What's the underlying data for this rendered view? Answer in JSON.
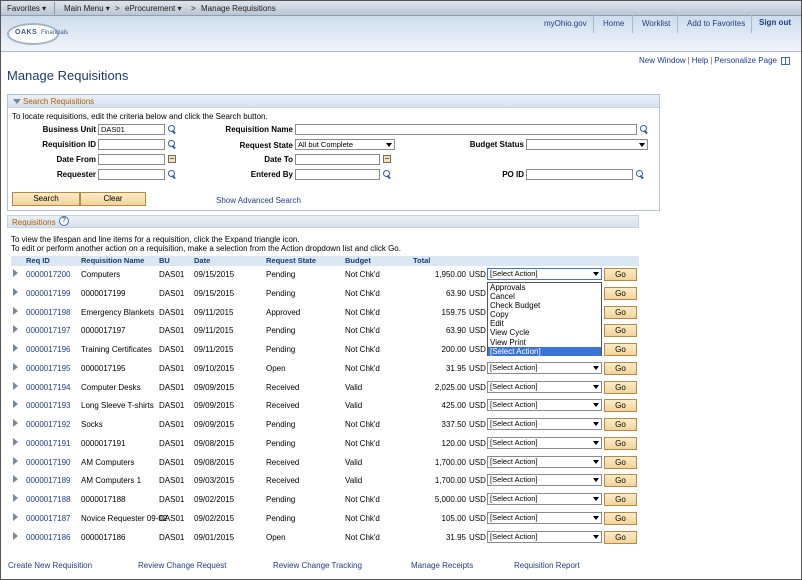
{
  "topnav": {
    "favorites": "Favorites",
    "main_menu": "Main Menu",
    "breadcrumb_1": "eProcurement",
    "breadcrumb_sep": ">",
    "breadcrumb_2": "Manage Requisitions"
  },
  "header": {
    "logo_text": "OAKS",
    "logo_sub": "Financials",
    "links": [
      "myOhio.gov",
      "Home",
      "Worklist",
      "Add to Favorites",
      "Sign out"
    ]
  },
  "page_links": [
    "New Window",
    "Help",
    "Personalize Page"
  ],
  "page_title": "Manage Requisitions",
  "search": {
    "section_title": "Search Requisitions",
    "instructions": "To locate requisitions, edit the criteria below and click the Search button.",
    "labels": {
      "business_unit": "Business Unit",
      "requisition_name": "Requisition Name",
      "requisition_id": "Requisition ID",
      "request_state": "Request State",
      "budget_status": "Budget Status",
      "date_from": "Date From",
      "date_to": "Date To",
      "requester": "Requester",
      "entered_by": "Entered By",
      "po_id": "PO ID"
    },
    "values": {
      "business_unit": "DAS01",
      "request_state": "All but Complete"
    },
    "search_button": "Search",
    "clear_button": "Clear",
    "advanced_link": "Show Advanced Search"
  },
  "requisitions": {
    "section_title": "Requisitions",
    "help_glyph": "?",
    "instructions_1": "To view the lifespan and line items for a requisition, click the Expand triangle icon.",
    "instructions_2": "To edit or perform another action on a requisition, make a selection from the Action dropdown list and click Go.",
    "columns": [
      "Req ID",
      "Requisition Name",
      "BU",
      "Date",
      "Request State",
      "Budget",
      "Total"
    ],
    "action_placeholder": "[Select Action]",
    "go_label": "Go",
    "rows": [
      {
        "id": "0000017200",
        "name": "Computers",
        "bu": "DAS01",
        "date": "09/15/2015",
        "state": "Pending",
        "budget": "Not Chk'd",
        "total": "1,950.00",
        "cur": "USD"
      },
      {
        "id": "0000017199",
        "name": "0000017199",
        "bu": "DAS01",
        "date": "09/15/2015",
        "state": "Pending",
        "budget": "Not Chk'd",
        "total": "63.90",
        "cur": "USD"
      },
      {
        "id": "0000017198",
        "name": "Emergency Blankets",
        "bu": "DAS01",
        "date": "09/11/2015",
        "state": "Approved",
        "budget": "Not Chk'd",
        "total": "159.75",
        "cur": "USD"
      },
      {
        "id": "0000017197",
        "name": "0000017197",
        "bu": "DAS01",
        "date": "09/11/2015",
        "state": "Pending",
        "budget": "Not Chk'd",
        "total": "63.90",
        "cur": "USD"
      },
      {
        "id": "0000017196",
        "name": "Training Certificates",
        "bu": "DAS01",
        "date": "09/11/2015",
        "state": "Pending",
        "budget": "Not Chk'd",
        "total": "200.00",
        "cur": "USD"
      },
      {
        "id": "0000017195",
        "name": "0000017195",
        "bu": "DAS01",
        "date": "09/10/2015",
        "state": "Open",
        "budget": "Not Chk'd",
        "total": "31.95",
        "cur": "USD"
      },
      {
        "id": "0000017194",
        "name": "Computer Desks",
        "bu": "DAS01",
        "date": "09/09/2015",
        "state": "Received",
        "budget": "Valid",
        "total": "2,025.00",
        "cur": "USD"
      },
      {
        "id": "0000017193",
        "name": "Long Sleeve T-shirts",
        "bu": "DAS01",
        "date": "09/09/2015",
        "state": "Received",
        "budget": "Valid",
        "total": "425.00",
        "cur": "USD"
      },
      {
        "id": "0000017192",
        "name": "Socks",
        "bu": "DAS01",
        "date": "09/09/2015",
        "state": "Pending",
        "budget": "Not Chk'd",
        "total": "337.50",
        "cur": "USD"
      },
      {
        "id": "0000017191",
        "name": "0000017191",
        "bu": "DAS01",
        "date": "09/08/2015",
        "state": "Pending",
        "budget": "Not Chk'd",
        "total": "120.00",
        "cur": "USD"
      },
      {
        "id": "0000017190",
        "name": "AM Computers",
        "bu": "DAS01",
        "date": "09/08/2015",
        "state": "Received",
        "budget": "Valid",
        "total": "1,700.00",
        "cur": "USD"
      },
      {
        "id": "0000017189",
        "name": "AM Computers 1",
        "bu": "DAS01",
        "date": "09/03/2015",
        "state": "Received",
        "budget": "Valid",
        "total": "1,700.00",
        "cur": "USD"
      },
      {
        "id": "0000017188",
        "name": "0000017188",
        "bu": "DAS01",
        "date": "09/02/2015",
        "state": "Pending",
        "budget": "Not Chk'd",
        "total": "5,000.00",
        "cur": "USD"
      },
      {
        "id": "0000017187",
        "name": "Novice Requester 09-02",
        "bu": "DAS01",
        "date": "09/02/2015",
        "state": "Pending",
        "budget": "Not Chk'd",
        "total": "105.00",
        "cur": "USD"
      },
      {
        "id": "0000017186",
        "name": "0000017186",
        "bu": "DAS01",
        "date": "09/01/2015",
        "state": "Open",
        "budget": "Not Chk'd",
        "total": "31.95",
        "cur": "USD"
      }
    ],
    "action_dropdown_open": {
      "options": [
        "Approvals",
        "Cancel",
        "Check Budget",
        "Copy",
        "Edit",
        "View Cycle",
        "View Print",
        "[Select Action]"
      ],
      "highlighted": "[Select Action]"
    }
  },
  "footer_links": [
    "Create New Requisition",
    "Review Change Request",
    "Review Change Tracking",
    "Manage Receipts",
    "Requisition Report"
  ],
  "colors": {
    "link": "#1b3f88",
    "section_title": "#b35a00",
    "title": "#1a3c73",
    "button": "#f3d39a",
    "highlight": "#3a74d6"
  }
}
